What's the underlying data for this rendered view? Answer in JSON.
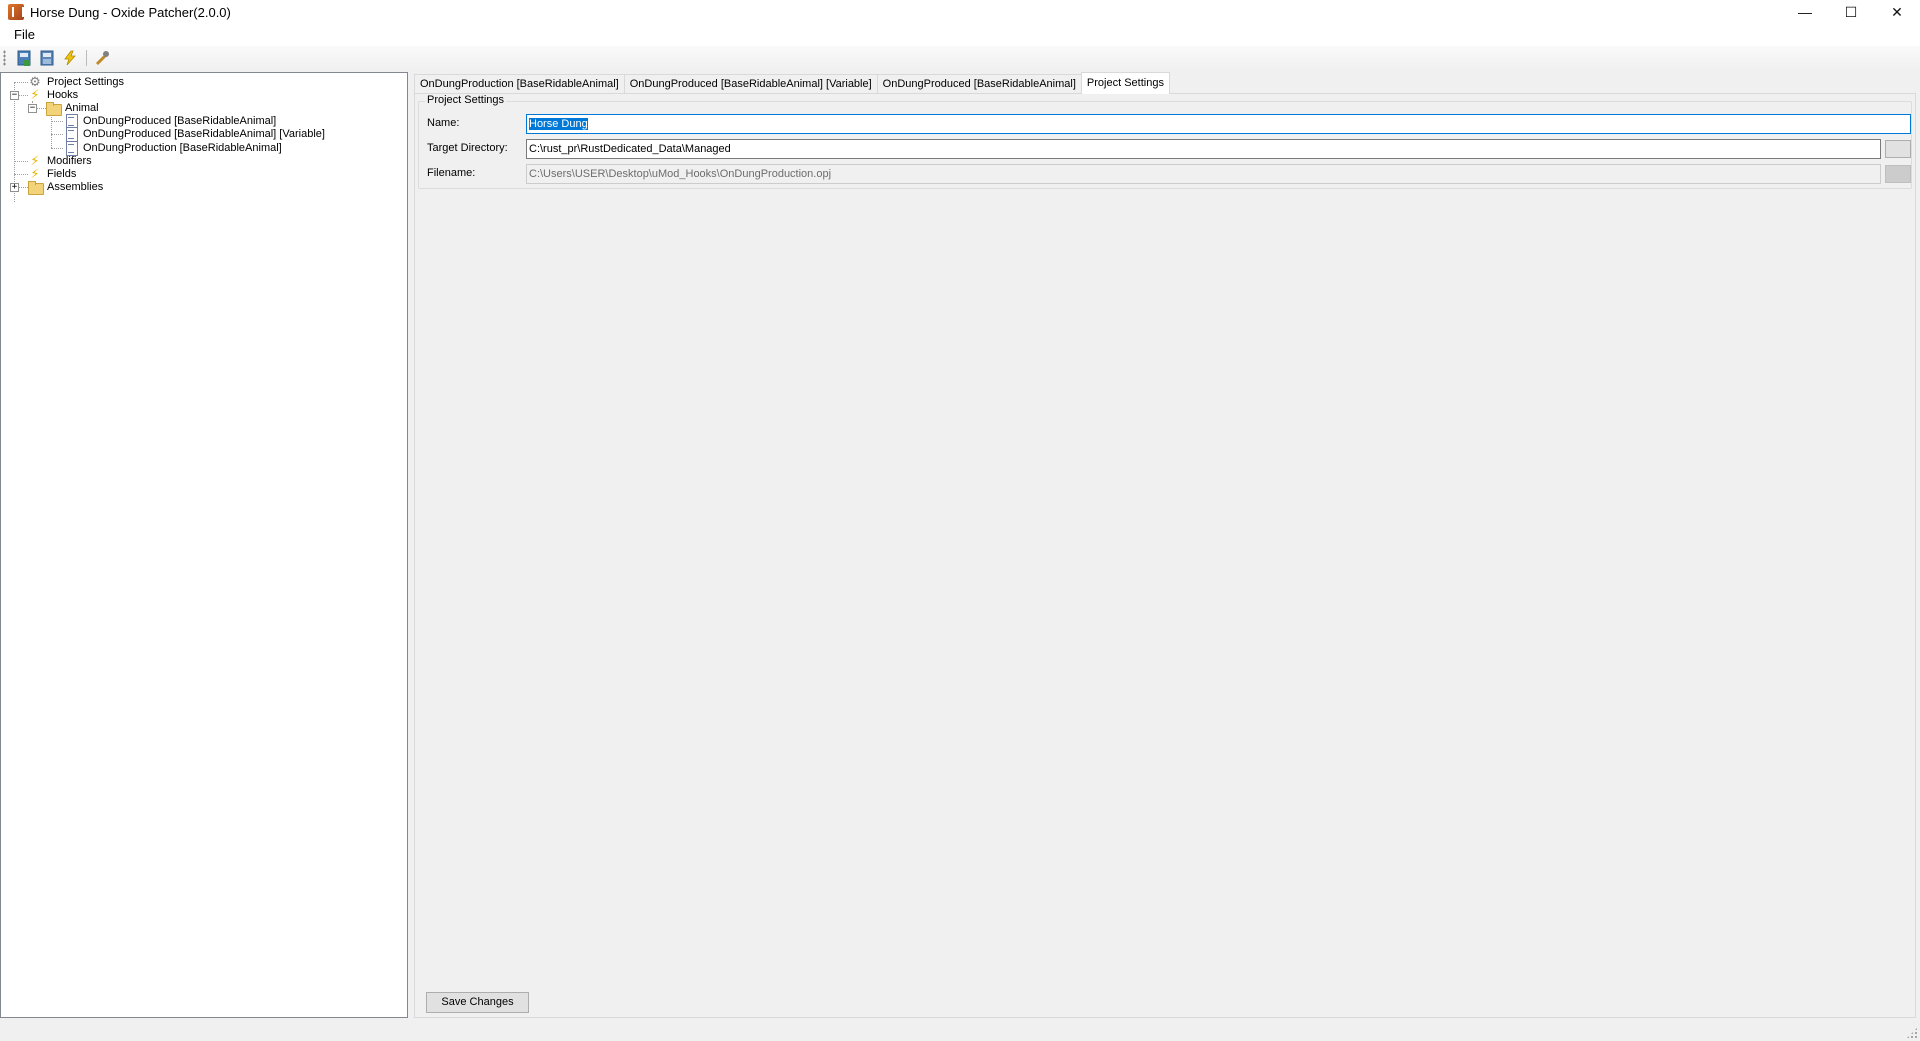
{
  "window": {
    "title": "Horse Dung - Oxide Patcher(2.0.0)",
    "controls": {
      "minimize": "—",
      "maximize": "☐",
      "close": "✕"
    }
  },
  "menu": {
    "items": [
      "File"
    ]
  },
  "toolbar": {
    "buttons": [
      "new-project-icon",
      "open-project-icon",
      "patch-icon",
      "settings-wrench-icon"
    ]
  },
  "tree": {
    "project_settings": "Project Settings",
    "hooks": "Hooks",
    "animal": "Animal",
    "hook_items": [
      "OnDungProduced [BaseRidableAnimal]",
      "OnDungProduced [BaseRidableAnimal] [Variable]",
      "OnDungProduction [BaseRidableAnimal]"
    ],
    "modifiers": "Modifiers",
    "fields": "Fields",
    "assemblies": "Assemblies",
    "expander_collapse": "−",
    "expander_expand": "+"
  },
  "tabs": [
    "OnDungProduction [BaseRidableAnimal]",
    "OnDungProduced [BaseRidableAnimal] [Variable]",
    "OnDungProduced [BaseRidableAnimal]",
    "Project Settings"
  ],
  "active_tab": "Project Settings",
  "project_settings": {
    "group_title": "Project Settings",
    "name_label": "Name:",
    "name_value": "Horse Dung",
    "target_dir_label": "Target Directory:",
    "target_dir_value": "C:\\rust_pr\\RustDedicated_Data\\Managed",
    "filename_label": "Filename:",
    "filename_value": "C:\\Users\\USER\\Desktop\\uMod_Hooks\\OnDungProduction.opj",
    "save_button": "Save Changes"
  },
  "colors": {
    "selection": "#0078d7",
    "tree_border": "#828790",
    "panel_bg": "#f0f0f0"
  }
}
